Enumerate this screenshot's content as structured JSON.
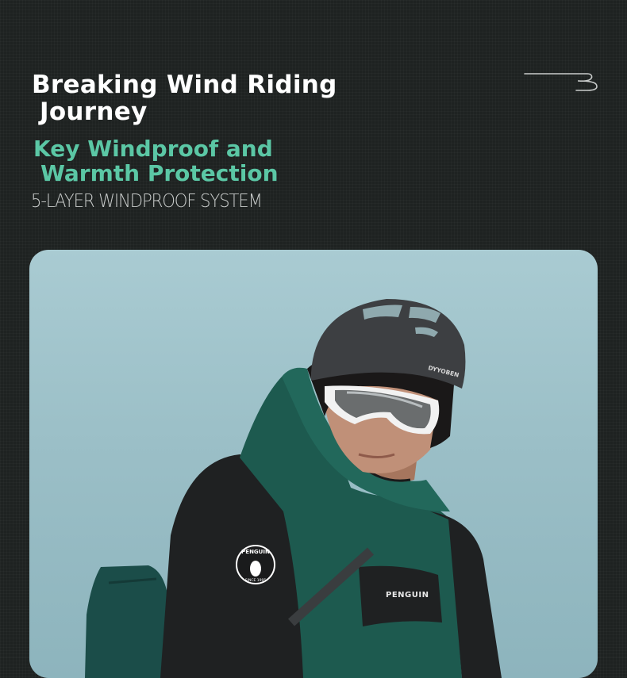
{
  "headline": {
    "line1": "Breaking Wind Riding",
    "line2": "Journey"
  },
  "subheading": {
    "line1": "Key Windproof and",
    "line2": "Warmth Protection"
  },
  "tagline": "5-LAYER WINDPROOF SYSTEM",
  "photo": {
    "helmet_brand": "DYYOBEN",
    "sleeve_patch_text": "PENGUIN",
    "sleeve_patch_subtext": "SINCE 1995",
    "jacket_chest_text": "PENGUIN"
  },
  "colors": {
    "background": "#1e2221",
    "headline": "#ffffff",
    "accent": "#5bc7a5",
    "tagline": "#c9cccb",
    "sky": "#a9cbd2",
    "jacket_green": "#1d5a4f",
    "jacket_black": "#1f2122"
  }
}
